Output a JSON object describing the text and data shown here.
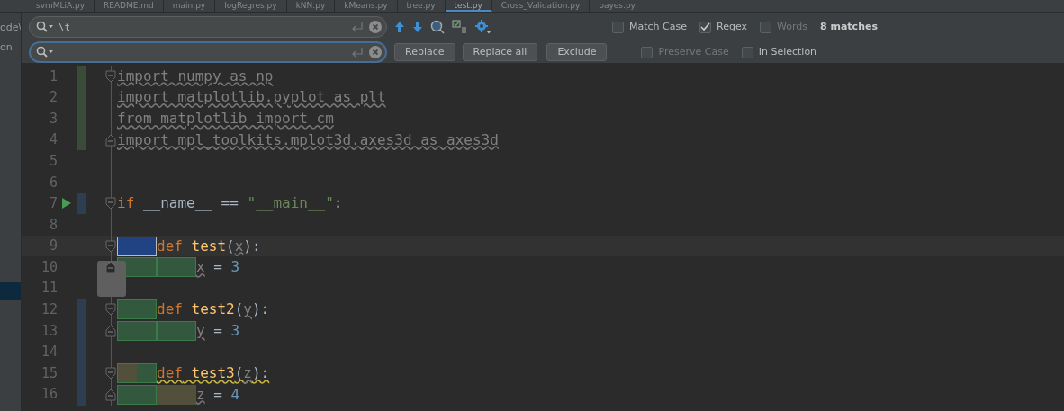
{
  "tabs": [
    {
      "label": "svmMLiA.py",
      "selected": false
    },
    {
      "label": "README.md",
      "selected": false
    },
    {
      "label": "main.py",
      "selected": false
    },
    {
      "label": "logRegres.py",
      "selected": false
    },
    {
      "label": "kNN.py",
      "selected": false
    },
    {
      "label": "kMeans.py",
      "selected": false
    },
    {
      "label": "tree.py",
      "selected": false
    },
    {
      "label": "test.py",
      "selected": true
    },
    {
      "label": "Cross_Validation.py",
      "selected": false
    },
    {
      "label": "bayes.py",
      "selected": false
    }
  ],
  "sidebar": {
    "items": [
      {
        "label": "ode\\",
        "selected": false
      },
      {
        "label": "on",
        "selected": false
      },
      {
        "selected": true
      }
    ]
  },
  "find": {
    "search_value": "\\t",
    "buttons": [
      "Replace",
      "Replace all",
      "Exclude"
    ],
    "option_rows": [
      [
        {
          "label": "Match Case",
          "checked": false,
          "disabled": false
        },
        {
          "label": "Regex",
          "checked": true,
          "disabled": false
        },
        {
          "label": "Words",
          "checked": false,
          "disabled": true
        }
      ],
      [
        {
          "label": "Preserve Case",
          "checked": false,
          "disabled": true
        },
        {
          "label": "In Selection",
          "checked": false,
          "disabled": false
        }
      ]
    ],
    "match_count": "8 matches"
  },
  "lines": [
    {
      "number": "1",
      "added": true,
      "fold_start": true,
      "tokens": [
        {
          "text": "import numpy as np",
          "kind": "unused"
        }
      ]
    },
    {
      "number": "2",
      "added": true,
      "tokens": [
        {
          "text": "import matplotlib.pyplot as plt",
          "kind": "unused"
        }
      ]
    },
    {
      "number": "3",
      "added": true,
      "tokens": [
        {
          "text": "from matplotlib import cm",
          "kind": "unused"
        }
      ]
    },
    {
      "number": "4",
      "added": true,
      "fold_end": true,
      "tokens": [
        {
          "text": "import mpl_toolkits.mplot3d.axes3d as axes3d",
          "kind": "unused"
        }
      ]
    },
    {
      "number": "5"
    },
    {
      "number": "6"
    },
    {
      "number": "7",
      "modified": true,
      "fold_start": true,
      "run": true,
      "tokens": [
        {
          "text": "if",
          "kind": "keyword"
        },
        {
          "text": " __name__ == ",
          "kind": "plain"
        },
        {
          "text": "\"__main__\"",
          "kind": "string"
        },
        {
          "text": ":",
          "kind": "plain"
        }
      ]
    },
    {
      "number": "8"
    },
    {
      "number": "9",
      "current": true,
      "fold_start": true,
      "matches": [
        {
          "kind": "current"
        }
      ],
      "tokens": [
        {
          "text": "def",
          "kind": "keyword"
        },
        {
          "text": " test",
          "kind": "func"
        },
        {
          "text": "(",
          "kind": "plain"
        },
        {
          "text": "x",
          "kind": "param"
        },
        {
          "text": "):",
          "kind": "plain"
        }
      ]
    },
    {
      "number": "10",
      "fold_end": true,
      "matches": [
        {
          "kind": "match"
        },
        {
          "kind": "match"
        }
      ],
      "tokens": [
        {
          "text": "x",
          "kind": "param"
        },
        {
          "text": " = ",
          "kind": "plain"
        },
        {
          "text": "3",
          "kind": "number"
        }
      ]
    },
    {
      "number": "11"
    },
    {
      "number": "12",
      "modified": true,
      "fold_start": true,
      "matches": [
        {
          "kind": "match"
        }
      ],
      "tokens": [
        {
          "text": "def",
          "kind": "keyword"
        },
        {
          "text": " test2",
          "kind": "func"
        },
        {
          "text": "(",
          "kind": "plain"
        },
        {
          "text": "y",
          "kind": "param"
        },
        {
          "text": "):",
          "kind": "plain"
        }
      ]
    },
    {
      "number": "13",
      "modified": true,
      "fold_end": true,
      "matches": [
        {
          "kind": "match"
        },
        {
          "kind": "match"
        }
      ],
      "tokens": [
        {
          "text": "y",
          "kind": "param"
        },
        {
          "text": " = ",
          "kind": "plain"
        },
        {
          "text": "3",
          "kind": "number"
        }
      ]
    },
    {
      "number": "14",
      "modified": true
    },
    {
      "number": "15",
      "modified": true,
      "fold_start": true,
      "warning": true,
      "matches": [
        {
          "kind": "split"
        }
      ],
      "tokens": [
        {
          "text": "def",
          "kind": "keyword"
        },
        {
          "text": " test3",
          "kind": "func"
        },
        {
          "text": "(",
          "kind": "plain"
        },
        {
          "text": "z",
          "kind": "param"
        },
        {
          "text": "):",
          "kind": "plain"
        }
      ]
    },
    {
      "number": "16",
      "modified": true,
      "fold_end": true,
      "matches": [
        {
          "kind": "match"
        },
        {
          "kind": "warning"
        }
      ],
      "tokens": [
        {
          "text": "z",
          "kind": "param"
        },
        {
          "text": " = ",
          "kind": "plain"
        },
        {
          "text": "4",
          "kind": "number"
        }
      ]
    }
  ]
}
